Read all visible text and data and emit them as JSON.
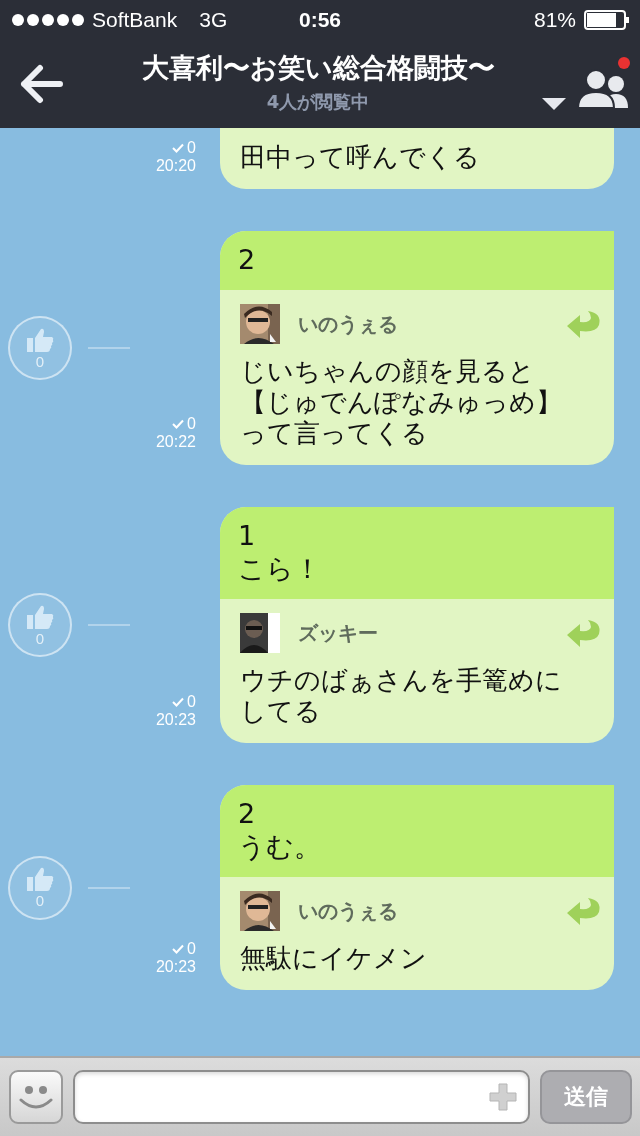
{
  "status_bar": {
    "carrier": "SoftBank",
    "network": "3G",
    "time": "0:56",
    "battery": "81%"
  },
  "nav": {
    "title": "大喜利〜お笑い総合格闘技〜",
    "subtitle": "4人が閲覧中",
    "notification": true
  },
  "messages": [
    {
      "kind": "partial",
      "read": "0",
      "time": "20:20",
      "reply": {
        "lines": [
          "田中って呼んでくる"
        ]
      }
    },
    {
      "kind": "full",
      "likes": "0",
      "read": "0",
      "time": "20:22",
      "lines": [
        "2"
      ],
      "reply": {
        "author": "いのうぇる",
        "lines": [
          "じいちゃんの顔を見ると",
          "【じゅでんぽなみゅっめ】",
          "って言ってくる"
        ]
      }
    },
    {
      "kind": "full",
      "likes": "0",
      "read": "0",
      "time": "20:23",
      "lines": [
        "1",
        "こら！"
      ],
      "reply": {
        "author": "ズッキー",
        "lines": [
          "ウチのばぁさんを手篭めに",
          "してる"
        ]
      }
    },
    {
      "kind": "full",
      "likes": "0",
      "read": "0",
      "time": "20:23",
      "lines": [
        "2",
        "うむ。"
      ],
      "reply": {
        "author": "いのうぇる",
        "lines": [
          "無駄にイケメン"
        ]
      }
    }
  ],
  "composer": {
    "send": "送信"
  }
}
